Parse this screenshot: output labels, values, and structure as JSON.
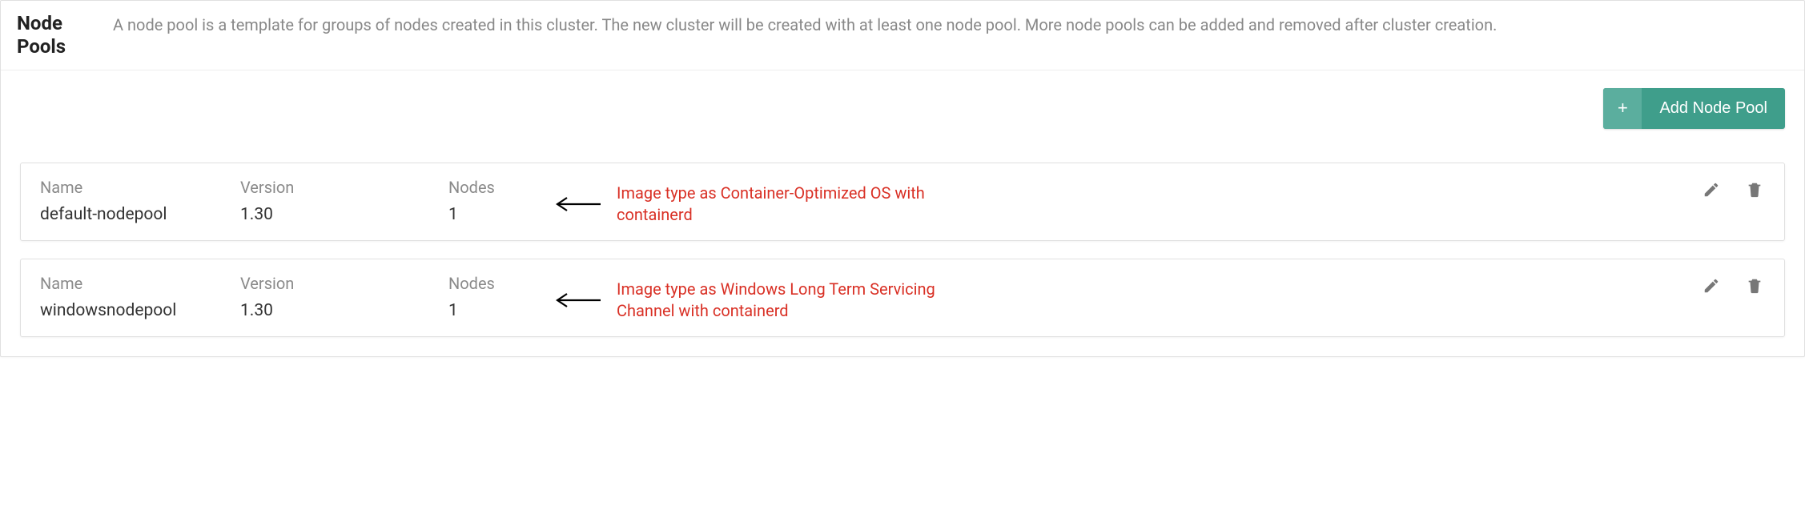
{
  "header": {
    "title": "Node Pools",
    "description": "A node pool is a template for groups of nodes created in this cluster. The new cluster will be created with at least one node pool. More node pools can be added and removed after cluster creation."
  },
  "actions": {
    "add_button_label": "Add Node Pool",
    "add_button_plus": "+"
  },
  "columns": {
    "name": "Name",
    "version": "Version",
    "nodes": "Nodes"
  },
  "pools": [
    {
      "name": "default-nodepool",
      "version": "1.30",
      "nodes": "1",
      "annotation": "Image type as  Container-Optimized OS with containerd"
    },
    {
      "name": "windowsnodepool",
      "version": "1.30",
      "nodes": "1",
      "annotation": "Image type as  Windows Long Term Servicing Channel with containerd"
    }
  ]
}
